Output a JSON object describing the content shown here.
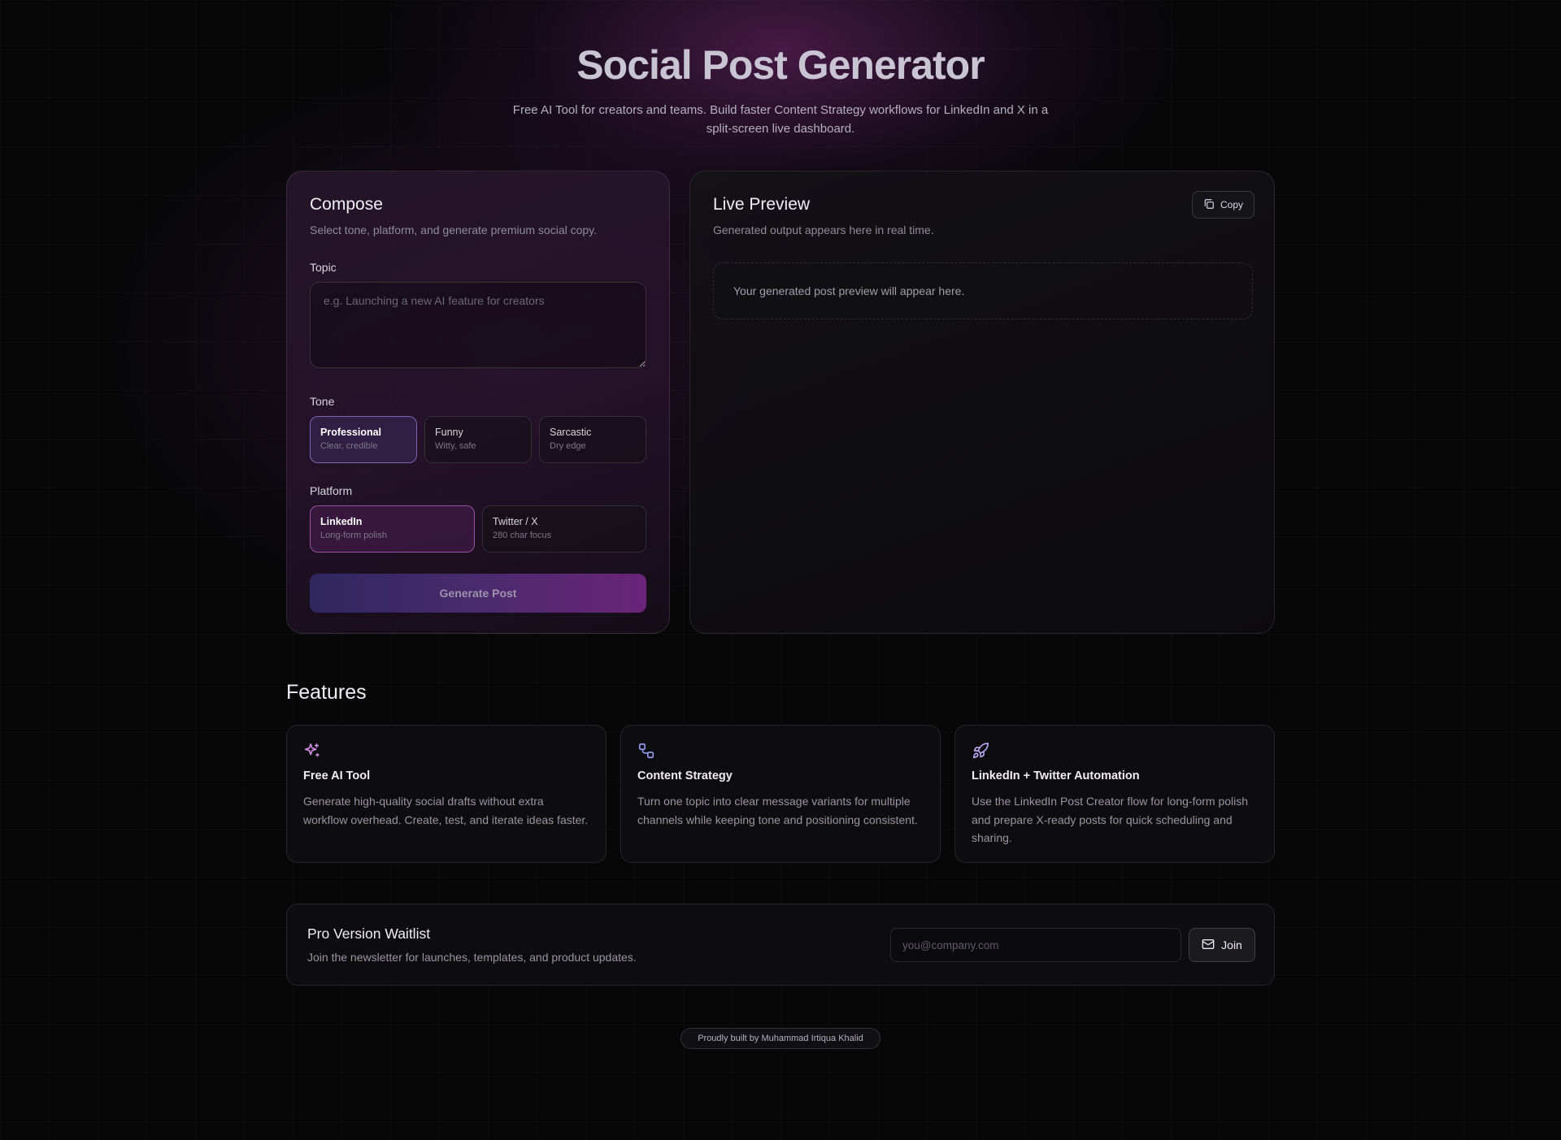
{
  "hero": {
    "title": "Social Post Generator",
    "subtitle": "Free AI Tool for creators and teams. Build faster Content Strategy workflows for LinkedIn and X in a split-screen live dashboard."
  },
  "compose": {
    "title": "Compose",
    "subtitle": "Select tone, platform, and generate premium social copy.",
    "topic_label": "Topic",
    "topic_placeholder": "e.g. Launching a new AI feature for creators",
    "topic_value": "",
    "tone_label": "Tone",
    "tones": [
      {
        "title": "Professional",
        "desc": "Clear, credible",
        "selected": true
      },
      {
        "title": "Funny",
        "desc": "Witty, safe",
        "selected": false
      },
      {
        "title": "Sarcastic",
        "desc": "Dry edge",
        "selected": false
      }
    ],
    "platform_label": "Platform",
    "platforms": [
      {
        "title": "LinkedIn",
        "desc": "Long-form polish",
        "selected": true
      },
      {
        "title": "Twitter / X",
        "desc": "280 char focus",
        "selected": false
      }
    ],
    "generate_label": "Generate Post"
  },
  "preview": {
    "title": "Live Preview",
    "subtitle": "Generated output appears here in real time.",
    "copy_label": "Copy",
    "copy_icon": "copy-icon",
    "placeholder": "Your generated post preview will appear here."
  },
  "features": {
    "title": "Features",
    "items": [
      {
        "icon": "sparkles-icon",
        "icon_color": "#d58ae6",
        "title": "Free AI Tool",
        "desc": "Generate high-quality social drafts without extra workflow overhead. Create, test, and iterate ideas faster."
      },
      {
        "icon": "workflow-icon",
        "icon_color": "#8f9cf0",
        "title": "Content Strategy",
        "desc": "Turn one topic into clear message variants for multiple channels while keeping tone and positioning consistent."
      },
      {
        "icon": "rocket-icon",
        "icon_color": "#b9a6f0",
        "title": "LinkedIn + Twitter Automation",
        "desc": "Use the LinkedIn Post Creator flow for long-form polish and prepare X-ready posts for quick scheduling and sharing."
      }
    ]
  },
  "waitlist": {
    "title": "Pro Version Waitlist",
    "subtitle": "Join the newsletter for launches, templates, and product updates.",
    "email_placeholder": "you@company.com",
    "email_value": "",
    "join_label": "Join",
    "join_icon": "mail-icon"
  },
  "footer": {
    "text": "Proudly built by Muhammad Irtiqua Khalid"
  },
  "colors": {
    "background": "#070708",
    "accent_purple": "#6a2478",
    "accent_indigo": "#2f2760"
  }
}
